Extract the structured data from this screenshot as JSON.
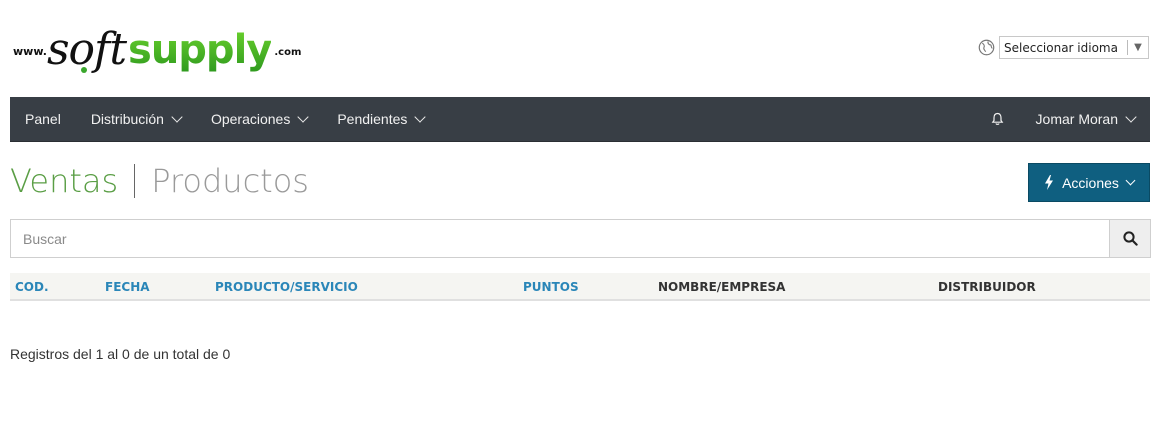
{
  "logo": {
    "www": "www.",
    "soft": "soft",
    "supply": "supply",
    "com": ".com"
  },
  "language": {
    "select_label": "Seleccionar idioma",
    "arrow": "▼"
  },
  "navbar": {
    "items": [
      {
        "label": "Panel"
      },
      {
        "label": "Distribución"
      },
      {
        "label": "Operaciones"
      },
      {
        "label": "Pendientes"
      }
    ],
    "user": "Jomar Moran"
  },
  "page": {
    "title_active": "Ventas",
    "title_inactive": "Productos",
    "actions_label": "Acciones"
  },
  "search": {
    "placeholder": "Buscar"
  },
  "table": {
    "columns": [
      {
        "label": "COD.",
        "sortable": true
      },
      {
        "label": "FECHA",
        "sortable": true
      },
      {
        "label": "PRODUCTO/SERVICIO",
        "sortable": true
      },
      {
        "label": "PUNTOS",
        "sortable": true
      },
      {
        "label": "NOMBRE/EMPRESA",
        "sortable": false
      },
      {
        "label": "DISTRIBUIDOR",
        "sortable": false
      }
    ]
  },
  "footer": {
    "records_text": "Registros del 1 al 0 de un total de 0"
  },
  "colors": {
    "navbar": "#383e45",
    "accent_green": "#5a9e45",
    "actions_button": "#0f5f80",
    "link_blue": "#2a86b8"
  }
}
